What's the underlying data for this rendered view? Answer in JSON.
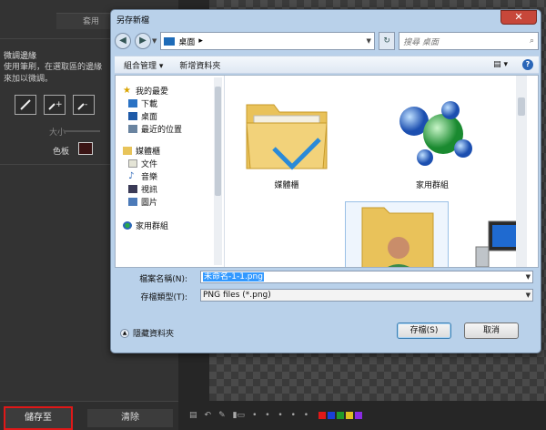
{
  "left_panel": {
    "apply_label": "套用",
    "section_title": "微調邊緣",
    "section_desc": "使用筆刷，在選取區的邊緣\n來加以微調。",
    "size_label": "大小",
    "swatch_label": "色板",
    "swatch_color": "#3a1414"
  },
  "bottom": {
    "save_to_label": "儲存至",
    "clear_label": "清除"
  },
  "canvas_toolbar": {
    "dots": "• • • • •",
    "colors": [
      "#e01818",
      "#1a3fd8",
      "#1f9a2a",
      "#e0c020",
      "#8a2be2"
    ]
  },
  "dialog": {
    "title": "另存新檔",
    "close_glyph": "✕",
    "address_path": "桌面",
    "address_arrow": "▸",
    "search_placeholder": "搜尋 桌面",
    "cmd_organize": "組合管理 ▾",
    "cmd_new_folder": "新增資料夾",
    "cmd_view": "▤ ▾",
    "help_glyph": "?",
    "nav": {
      "favorites": "我的最愛",
      "downloads": "下載",
      "desktop": "桌面",
      "recent": "最近的位置",
      "libraries": "媒體櫃",
      "documents": "文件",
      "music": "音樂",
      "videos": "視訊",
      "pictures": "圖片",
      "homegroup": "家用群組"
    },
    "files": {
      "libraries": "媒體櫃",
      "homegroup": "家用群組"
    },
    "filename_label": "檔案名稱(N):",
    "filename_value": "未命名-1-1.png",
    "filetype_label": "存檔類型(T):",
    "filetype_value": "PNG files (*.png)",
    "hide_folders": "隱藏資料夾",
    "save_button": "存檔(S)",
    "cancel_button": "取消"
  }
}
